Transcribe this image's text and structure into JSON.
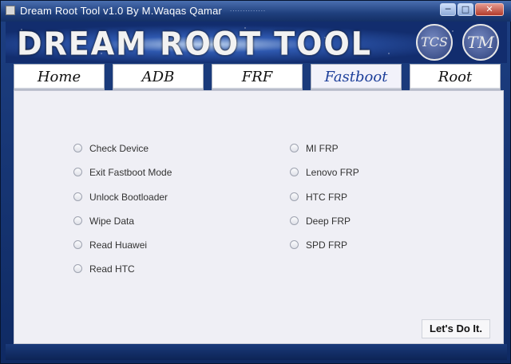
{
  "window": {
    "title": "Dream Root Tool v1.0 By M.Waqas Qamar",
    "title_suffix": "··············",
    "minimize": "─",
    "maximize": "□",
    "close": "✕"
  },
  "banner": {
    "logo_text": "DREAM ROOT TOOL",
    "badge_left": "TCS",
    "badge_right": "TM"
  },
  "tabs": [
    {
      "label": "Home"
    },
    {
      "label": "ADB"
    },
    {
      "label": "FRF"
    },
    {
      "label": "Fastboot",
      "active": true
    },
    {
      "label": "Root"
    }
  ],
  "options_left": [
    {
      "label": "Check Device"
    },
    {
      "label": "Exit Fastboot Mode"
    },
    {
      "label": "Unlock Bootloader"
    },
    {
      "label": "Wipe Data"
    },
    {
      "label": "Read Huawei"
    },
    {
      "label": "Read HTC"
    }
  ],
  "options_right": [
    {
      "label": "MI FRP"
    },
    {
      "label": "Lenovo FRP"
    },
    {
      "label": "HTC FRP"
    },
    {
      "label": "Deep FRP"
    },
    {
      "label": "SPD FRP"
    }
  ],
  "action_button": "Let's Do It.",
  "colors": {
    "title_bar": "#1f3f7d",
    "active_tab_text": "#1d3f9a",
    "panel_background": "#efeff5"
  }
}
